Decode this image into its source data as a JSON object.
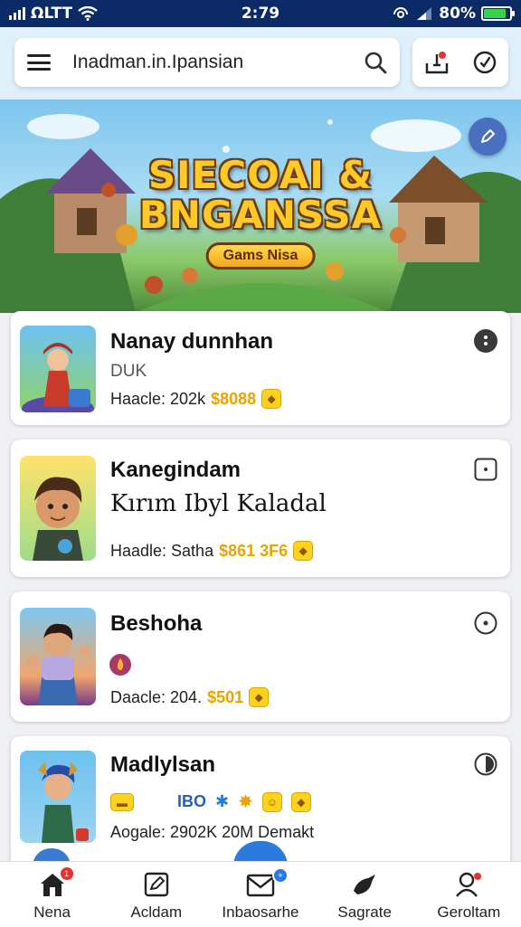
{
  "status": {
    "carrier": "ΩLTT",
    "time": "2:79",
    "battery": "80%",
    "battery_level": 0.8
  },
  "header": {
    "search_text": "Inadman.in.Ipansian"
  },
  "banner": {
    "title_line1": "SIECOAI &",
    "title_line2": "BNGANSSA",
    "subtitle": "Gams Nisa"
  },
  "cards": [
    {
      "title": "Nanay dunnhan",
      "sub": "DUK",
      "stats": "Haacle: 202k",
      "price": "$8088"
    },
    {
      "title": "Kanegindam",
      "sub": "Kırım Ibyl Kaladal",
      "stats": "Haadle: Satha",
      "price": "$861 3F6"
    },
    {
      "title": "Beshoha",
      "sub": "",
      "stats": "Daacle: 204.",
      "price": "$501"
    },
    {
      "title": "Madlylsan",
      "sub": "",
      "stats": "Aogale: 2902K 20M Demakt",
      "price": "",
      "badge_text": "IBO"
    }
  ],
  "nav": [
    {
      "label": "Nena"
    },
    {
      "label": "Acldam"
    },
    {
      "label": "Inbaosarhe"
    },
    {
      "label": "Sagrate"
    },
    {
      "label": "Geroltam"
    }
  ],
  "colors": {
    "status_bar": "#0b2a66",
    "accent": "#4a6fbf",
    "price": "#e8a400",
    "badge": "#e53232"
  }
}
